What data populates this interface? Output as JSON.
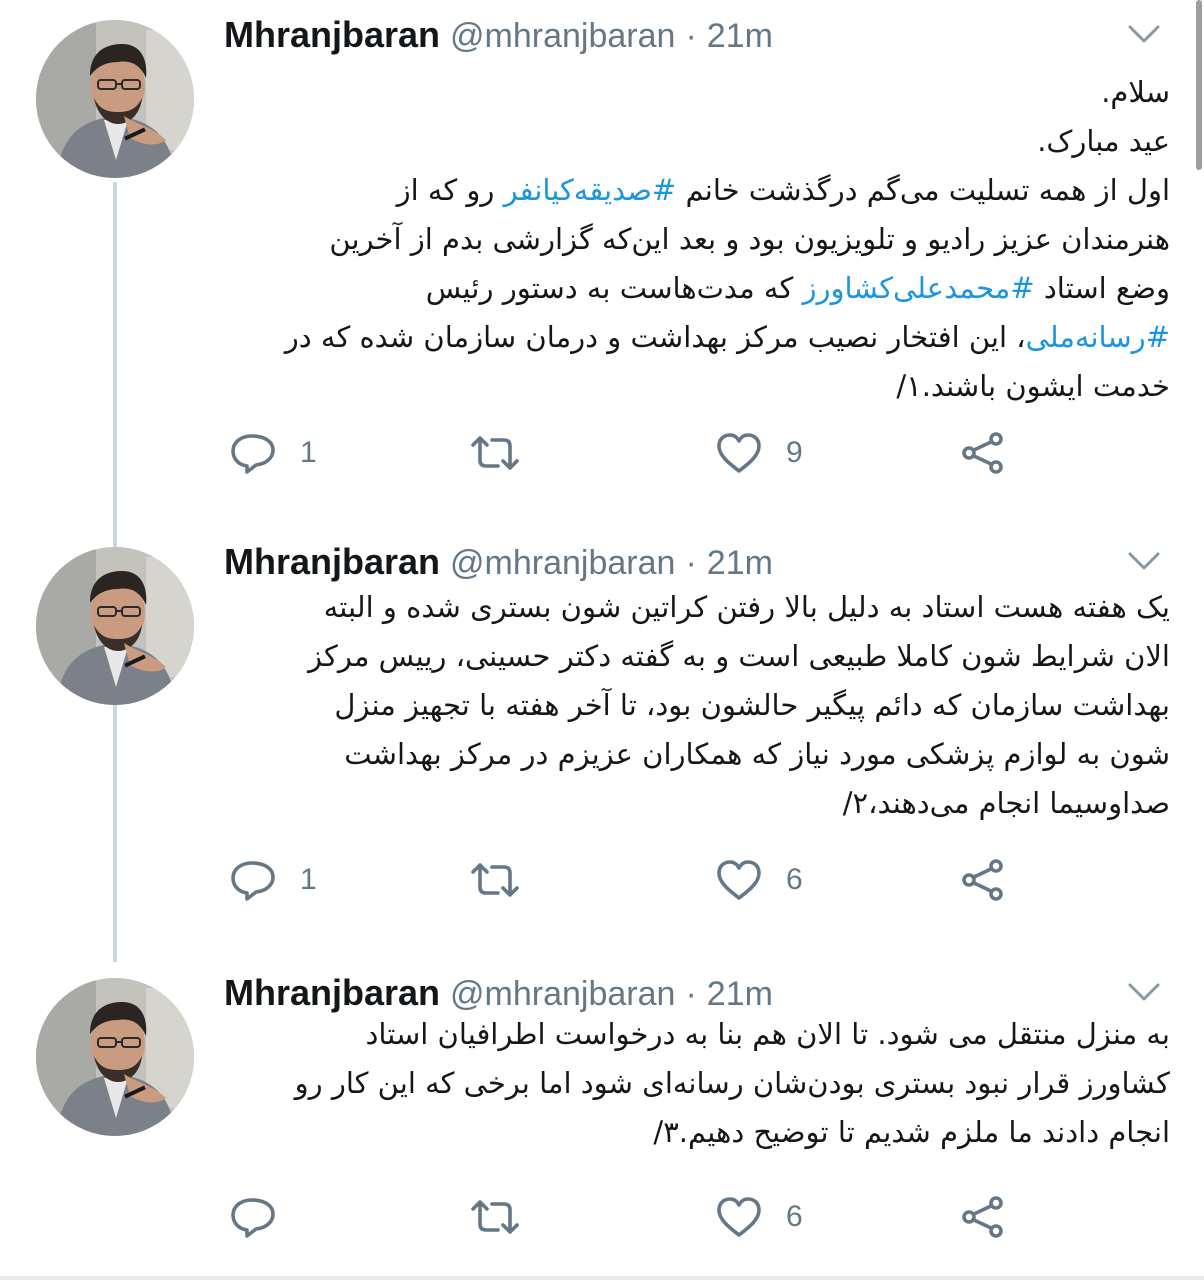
{
  "tweets": [
    {
      "name": "Mhranjbaran",
      "handle": "@mhranjbaran",
      "separator": "·",
      "time": "21m",
      "lines": [
        [
          {
            "t": "سلام."
          }
        ],
        [
          {
            "t": "عید مبارک."
          }
        ],
        [
          {
            "t": "اول از همه تسلیت می‌گم درگذشت خانم "
          },
          {
            "t": "#صدیقه‌کیانفر",
            "tag": true
          },
          {
            "t": " رو که از"
          }
        ],
        [
          {
            "t": "هنرمندان عزیز رادیو و تلویزیون بود و بعد این‌که گزارشی بدم از آخرین"
          }
        ],
        [
          {
            "t": "وضع استاد "
          },
          {
            "t": "#محمدعلی‌کشاورز",
            "tag": true
          },
          {
            "t": " که مدت‌هاست به دستور رئیس"
          }
        ],
        [
          {
            "t": "#رسانه‌ملی",
            "tag": true
          },
          {
            "t": "، این افتخار نصیب مرکز بهداشت و درمان سازمان شده که در"
          }
        ],
        [
          {
            "t": "خدمت ایشون باشند.۱/"
          }
        ]
      ],
      "reply_count": "1",
      "like_count": "9"
    },
    {
      "name": "Mhranjbaran",
      "handle": "@mhranjbaran",
      "separator": "·",
      "time": "21m",
      "lines": [
        [
          {
            "t": "یک هفته هست استاد به دلیل بالا رفتن کراتین شون بستری شده و البته"
          }
        ],
        [
          {
            "t": "الان شرایط شون کاملا طبیعی است و به گفته دکتر حسینی، رییس مرکز"
          }
        ],
        [
          {
            "t": "بهداشت سازمان که دائم پیگیر حالشون بود، تا آخر هفته با تجهیز منزل"
          }
        ],
        [
          {
            "t": "شون به لوازم پزشکی مورد نیاز که همکاران عزیزم در مرکز بهداشت"
          }
        ],
        [
          {
            "t": "صداوسیما انجام می‌دهند،۲/"
          }
        ]
      ],
      "reply_count": "1",
      "like_count": "6"
    },
    {
      "name": "Mhranjbaran",
      "handle": "@mhranjbaran",
      "separator": "·",
      "time": "21m",
      "lines": [
        [
          {
            "t": "به منزل منتقل می شود. تا الان هم بنا به درخواست اطرافیان استاد"
          }
        ],
        [
          {
            "t": "کشاورز قرار نبود بستری بودن‌شان رسانه‌ای شود اما برخی که این کار رو"
          }
        ],
        [
          {
            "t": "انجام دادند ما ملزم شدیم تا توضیح دهیم.۳/"
          }
        ]
      ],
      "reply_count": "",
      "like_count": "6"
    }
  ],
  "icons": {
    "reply": "speech-bubble-icon",
    "retweet": "retweet-arrows-icon",
    "like": "heart-outline-icon",
    "share": "share-nodes-icon",
    "menu": "chevron-down-icon"
  },
  "colors": {
    "hashtag": "#1b95e0",
    "secondary_text": "#657786",
    "thread_line": "#ccd6dd"
  }
}
